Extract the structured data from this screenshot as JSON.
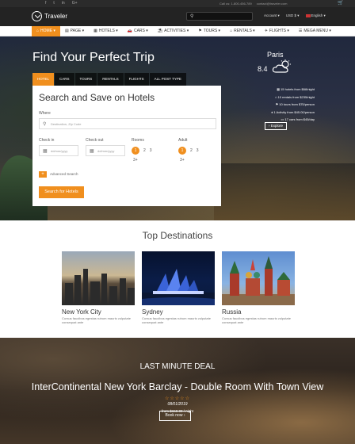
{
  "topbar": {
    "social": [
      "f",
      "t",
      "in",
      "G+"
    ],
    "phone": "Call us: 1-800-456-789",
    "email": "contact@traveler.com",
    "cart": "🛒"
  },
  "header": {
    "logo_text": "Traveler",
    "account": "Account ▾",
    "currency": "USD $ ▾",
    "language": "English ▾"
  },
  "nav": [
    {
      "label": "HOME ▾",
      "icon": "⌂",
      "active": true
    },
    {
      "label": "PAGE ▾",
      "icon": "▤",
      "active": false
    },
    {
      "label": "HOTELS ▾",
      "icon": "▦",
      "active": false
    },
    {
      "label": "CARS ▾",
      "icon": "🚗",
      "active": false
    },
    {
      "label": "ACTIVITIES ▾",
      "icon": "⛱",
      "active": false
    },
    {
      "label": "TOURS ▾",
      "icon": "⚑",
      "active": false
    },
    {
      "label": "RENTALS ▾",
      "icon": "⌂",
      "active": false
    },
    {
      "label": "FLIGHTS ▾",
      "icon": "✈",
      "active": false
    },
    {
      "label": "MEGA MENU ▾",
      "icon": "☰",
      "active": false
    }
  ],
  "hero": {
    "title": "Find Your Perfect Trip",
    "tabs": [
      "HOTEL",
      "CARS",
      "TOURS",
      "RENTALS",
      "FLIGHTS",
      "ALL POST TYPE"
    ],
    "card_title": "Search and Save on Hotels",
    "where_label": "Where",
    "where_placeholder": "Destination, Zip Code",
    "checkin_label": "Check in",
    "checkin_placeholder": "dd/mm/yyyy",
    "checkout_label": "Check out",
    "checkout_placeholder": "dd/mm/yyyy",
    "rooms_label": "Rooms",
    "rooms_options": [
      "1",
      "2",
      "3",
      "3+"
    ],
    "adult_label": "Adult",
    "adult_options": [
      "1",
      "2",
      "3",
      "3+"
    ],
    "advanced_label": "Advanced Search",
    "search_button": "Search for Hotels"
  },
  "weather": {
    "city": "Paris",
    "temp": "8.4"
  },
  "stats": [
    "15 hotels from $68/night",
    "10 rentals from $235/night",
    "10 tours from $75/person",
    "1 Activity from $45.00/person",
    "17 cars from $45/day"
  ],
  "explore_label": "Explore",
  "destinations": {
    "title": "Top Destinations",
    "items": [
      {
        "name": "New York City",
        "desc": "Cursus faucibus egestas rutrum mauris vulputate consequat ante"
      },
      {
        "name": "Sydney",
        "desc": "Cursus faucibus egestas rutrum mauris vulputate consequat ante"
      },
      {
        "name": "Russia",
        "desc": "Cursus faucibus egestas rutrum mauris vulputate consequat ante"
      }
    ]
  },
  "deal": {
    "kicker": "LAST MINUTE DEAL",
    "title": "InterContinental New York Barclay - Double Room With Town View",
    "stars": "☆☆☆☆☆",
    "date": "08/01/2019",
    "price": "from $150.00 / night",
    "button": "Book now ›"
  },
  "colors": {
    "accent": "#f08f1e",
    "dark": "#232323"
  }
}
